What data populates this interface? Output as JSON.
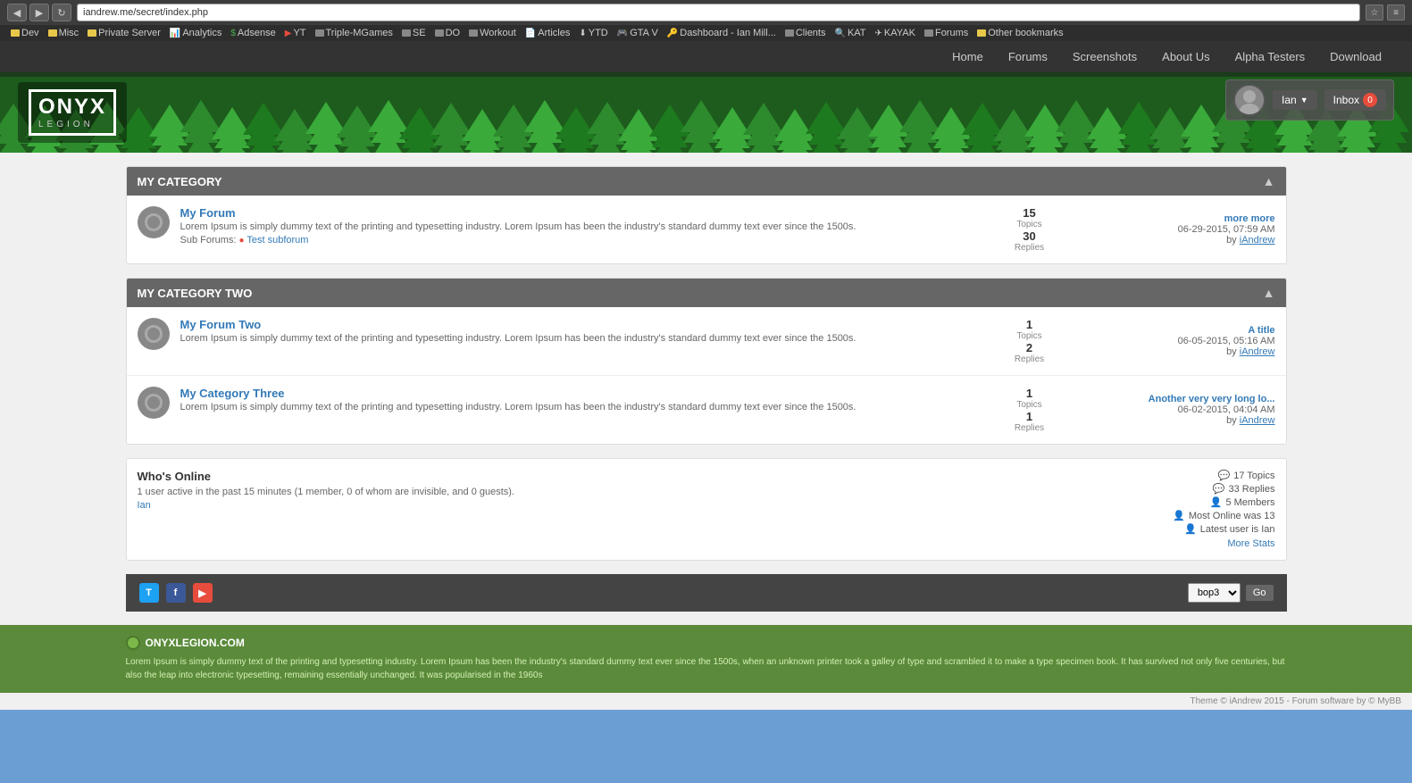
{
  "browser": {
    "url": "iandrew.me/secret/index.php",
    "back_btn": "◀",
    "forward_btn": "▶",
    "refresh_btn": "↻"
  },
  "bookmarks": [
    {
      "label": "Dev",
      "type": "folder"
    },
    {
      "label": "Misc",
      "type": "folder"
    },
    {
      "label": "Private Server",
      "type": "folder"
    },
    {
      "label": "Analytics",
      "type": "bookmark",
      "icon": "📊"
    },
    {
      "label": "Adsense",
      "type": "bookmark"
    },
    {
      "label": "YT",
      "type": "bookmark"
    },
    {
      "label": "Triple-MGames",
      "type": "folder"
    },
    {
      "label": "SE",
      "type": "folder"
    },
    {
      "label": "DO",
      "type": "folder"
    },
    {
      "label": "Workout",
      "type": "folder"
    },
    {
      "label": "Articles",
      "type": "bookmark"
    },
    {
      "label": "YTD",
      "type": "bookmark"
    },
    {
      "label": "GTA V",
      "type": "bookmark"
    },
    {
      "label": "Dashboard - Ian Mill...",
      "type": "bookmark"
    },
    {
      "label": "Clients",
      "type": "folder"
    },
    {
      "label": "KAT",
      "type": "bookmark"
    },
    {
      "label": "KAYAK",
      "type": "bookmark"
    },
    {
      "label": "Forums",
      "type": "folder"
    },
    {
      "label": "Other bookmarks",
      "type": "folder"
    }
  ],
  "nav": {
    "items": [
      "Home",
      "Forums",
      "Screenshots",
      "About Us",
      "Alpha Testers",
      "Download"
    ]
  },
  "logo": {
    "line1": "ONYX",
    "line2": "LEGION"
  },
  "user": {
    "name": "Ian",
    "inbox_label": "Inbox",
    "inbox_count": "0"
  },
  "categories": [
    {
      "id": "cat1",
      "title": "MY CATEGORY",
      "forums": [
        {
          "title": "My Forum",
          "description": "Lorem Ipsum is simply dummy text of the printing and typesetting industry. Lorem Ipsum has been the industry's standard dummy text ever since the 1500s.",
          "subforums_label": "Sub Forums:",
          "subforums": [
            "Test subforum"
          ],
          "topics": 15,
          "topics_label": "Topics",
          "replies": 30,
          "replies_label": "Replies",
          "last_post_title": "more more",
          "last_post_date": "06-29-2015, 07:59 AM",
          "last_post_by": "iAndrew"
        }
      ]
    },
    {
      "id": "cat2",
      "title": "MY CATEGORY TWO",
      "forums": [
        {
          "title": "My Forum Two",
          "description": "Lorem Ipsum is simply dummy text of the printing and typesetting industry. Lorem Ipsum has been the industry's standard dummy text ever since the 1500s.",
          "subforums_label": "",
          "subforums": [],
          "topics": 1,
          "topics_label": "Topics",
          "replies": 2,
          "replies_label": "Replies",
          "last_post_title": "A title",
          "last_post_date": "06-05-2015, 05:16 AM",
          "last_post_by": "iAndrew"
        },
        {
          "title": "My Category Three",
          "description": "Lorem Ipsum is simply dummy text of the printing and typesetting industry. Lorem Ipsum has been the industry's standard dummy text ever since the 1500s.",
          "subforums_label": "",
          "subforums": [],
          "topics": 1,
          "topics_label": "Topics",
          "replies": 1,
          "replies_label": "Replies",
          "last_post_title": "Another very very long lo...",
          "last_post_date": "06-02-2015, 04:04 AM",
          "last_post_by": "iAndrew"
        }
      ]
    }
  ],
  "whos_online": {
    "title": "Who's Online",
    "description": "1 user active in the past 15 minutes (1 member, 0 of whom are invisible, and 0 guests).",
    "users": [
      "Ian"
    ],
    "stats": [
      {
        "icon": "💬",
        "text": "17 Topics"
      },
      {
        "icon": "💬",
        "text": "33 Replies"
      },
      {
        "icon": "👤",
        "text": "5 Members"
      },
      {
        "icon": "👤",
        "text": "Most Online was 13"
      },
      {
        "icon": "👤",
        "text": "Latest user is Ian"
      }
    ],
    "more_stats_label": "More Stats"
  },
  "footer": {
    "social": [
      "T",
      "F",
      "Y"
    ],
    "select_default": "bop3",
    "go_btn": "Go"
  },
  "site_bottom": {
    "logo_text": "ONYXLEGION.COM",
    "description": "Lorem Ipsum is simply dummy text of the printing and typesetting industry. Lorem Ipsum has been the industry's standard dummy text ever since the 1500s, when an unknown printer took a galley of type and scrambled it to make a type specimen book. It has survived not only five centuries, but also the leap into electronic typesetting, remaining essentially unchanged. It was popularised in the 1960s"
  },
  "theme_credit": "Theme © iAndrew 2015 - Forum software by © MyBB"
}
